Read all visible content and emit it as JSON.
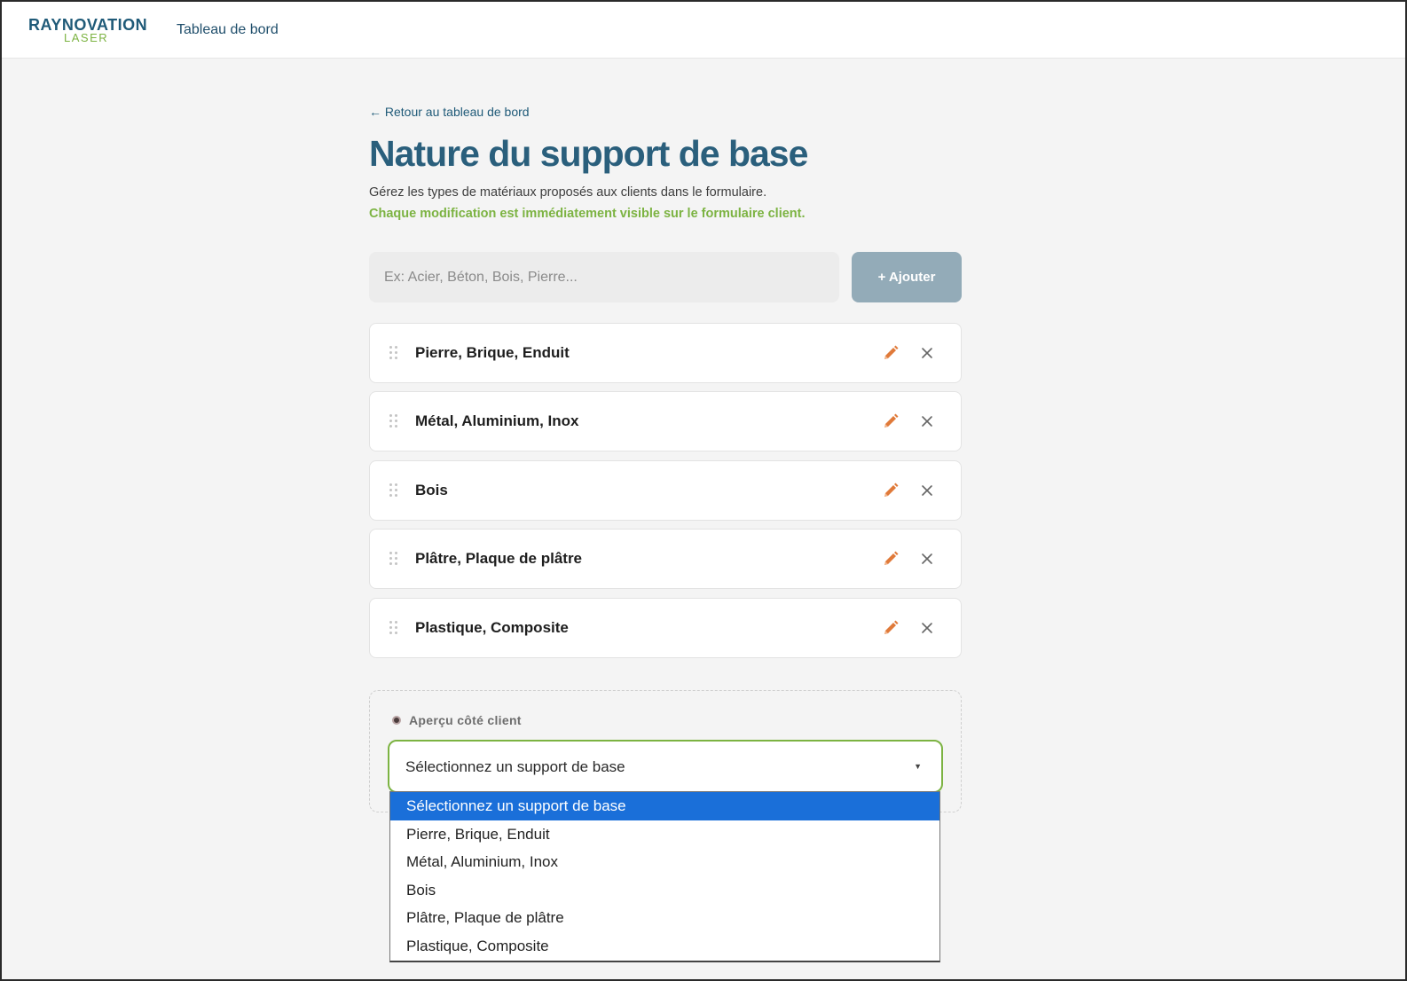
{
  "header": {
    "logo_main": "RAYNOVATION",
    "logo_sub": "LASER",
    "nav_link": "Tableau de bord"
  },
  "main": {
    "back_link": "← Retour au tableau de bord",
    "title": "Nature du support de base",
    "description": "Gérez les types de matériaux proposés aux clients dans le formulaire.",
    "description_highlight": "Chaque modification est immédiatement visible sur le formulaire client.",
    "add_input_placeholder": "Ex: Acier, Béton, Bois, Pierre...",
    "add_button_label": "+ Ajouter",
    "items": [
      {
        "label": "Pierre, Brique, Enduit"
      },
      {
        "label": "Métal, Aluminium, Inox"
      },
      {
        "label": "Bois"
      },
      {
        "label": "Plâtre, Plaque de plâtre"
      },
      {
        "label": "Plastique, Composite"
      }
    ],
    "icons": {
      "drag": "drag-handle-icon",
      "edit": "pencil-icon",
      "delete": "close-icon",
      "preview": "eye-icon",
      "caret": "caret-down-icon"
    }
  },
  "preview": {
    "label": "Aperçu côté client",
    "select_value": "Sélectionnez un support de base",
    "caret": "▼",
    "options": [
      {
        "label": "Sélectionnez un support de base",
        "selected": true
      },
      {
        "label": "Pierre, Brique, Enduit"
      },
      {
        "label": "Métal, Aluminium, Inox"
      },
      {
        "label": "Bois"
      },
      {
        "label": "Plâtre, Plaque de plâtre"
      },
      {
        "label": "Plastique, Composite"
      }
    ]
  },
  "colors": {
    "brand_blue": "#2a5f7c",
    "brand_green": "#7cb342",
    "edit_icon": "#e07a3a",
    "button_bg": "#93abb8",
    "selected_option": "#1a6fd9"
  }
}
